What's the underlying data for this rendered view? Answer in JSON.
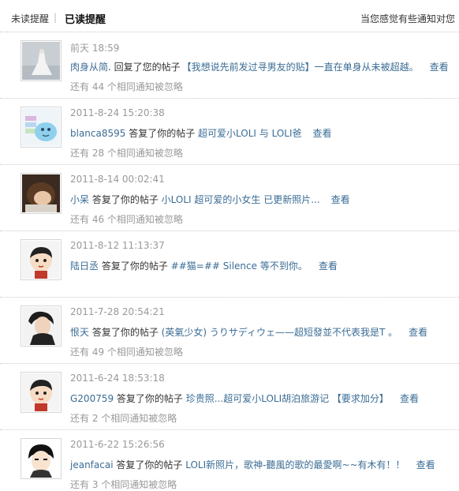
{
  "tabs": {
    "unread": "未读提醒",
    "separator": "|",
    "read": "已读提醒"
  },
  "hint": "当您感觉有些通知对您",
  "items": [
    {
      "time": "前天 18:59",
      "user": "肉身从简",
      "action": ". 回复了您的帖子",
      "post": "【我想说先前发过寻男友的贴】一直在单身从未被超越。",
      "view": "查看",
      "ignored": "还有 44 个相同通知被忽略"
    },
    {
      "time": "2011-8-24 15:20:38",
      "user": "blanca8595",
      "action": " 答复了你的帖子 ",
      "post": "超可爱小LOLI 与 LOLI爸",
      "view": "查看",
      "ignored": "还有 28 个相同通知被忽略"
    },
    {
      "time": "2011-8-14 00:02:41",
      "user": "小呆",
      "action": " 答复了你的帖子 ",
      "post": "小LOLI 超可爱的小女生 已更新照片...",
      "view": "查看",
      "ignored": "还有 46 个相同通知被忽略"
    },
    {
      "time": "2011-8-12 11:13:37",
      "user": "陆日丞",
      "action": " 答复了你的帖子 ",
      "post": "##猫=## Silence 等不到你。",
      "view": "查看",
      "ignored": ""
    },
    {
      "time": "2011-7-28 20:54:21",
      "user": "恨天",
      "action": " 答复了你的帖子 ",
      "post": "(英氣少女) うりサディウェ——超短發並不代表我是T 。",
      "view": "查看",
      "ignored": "还有 49 个相同通知被忽略"
    },
    {
      "time": "2011-6-24 18:53:18",
      "user": "G200759",
      "action": " 答复了你的帖子 ",
      "post": "珍贵照...超可爱小LOLI胡泊旅游记 【要求加分】",
      "view": "查看",
      "ignored": "还有 2 个相同通知被忽略"
    },
    {
      "time": "2011-6-22 15:26:56",
      "user": "jeanfacai",
      "action": " 答复了你的帖子 ",
      "post": "LOLI新照片，歌神-聽風的歌的最愛啊~~有木有！！",
      "view": "查看",
      "ignored": "还有 3 个相同通知被忽略"
    }
  ]
}
